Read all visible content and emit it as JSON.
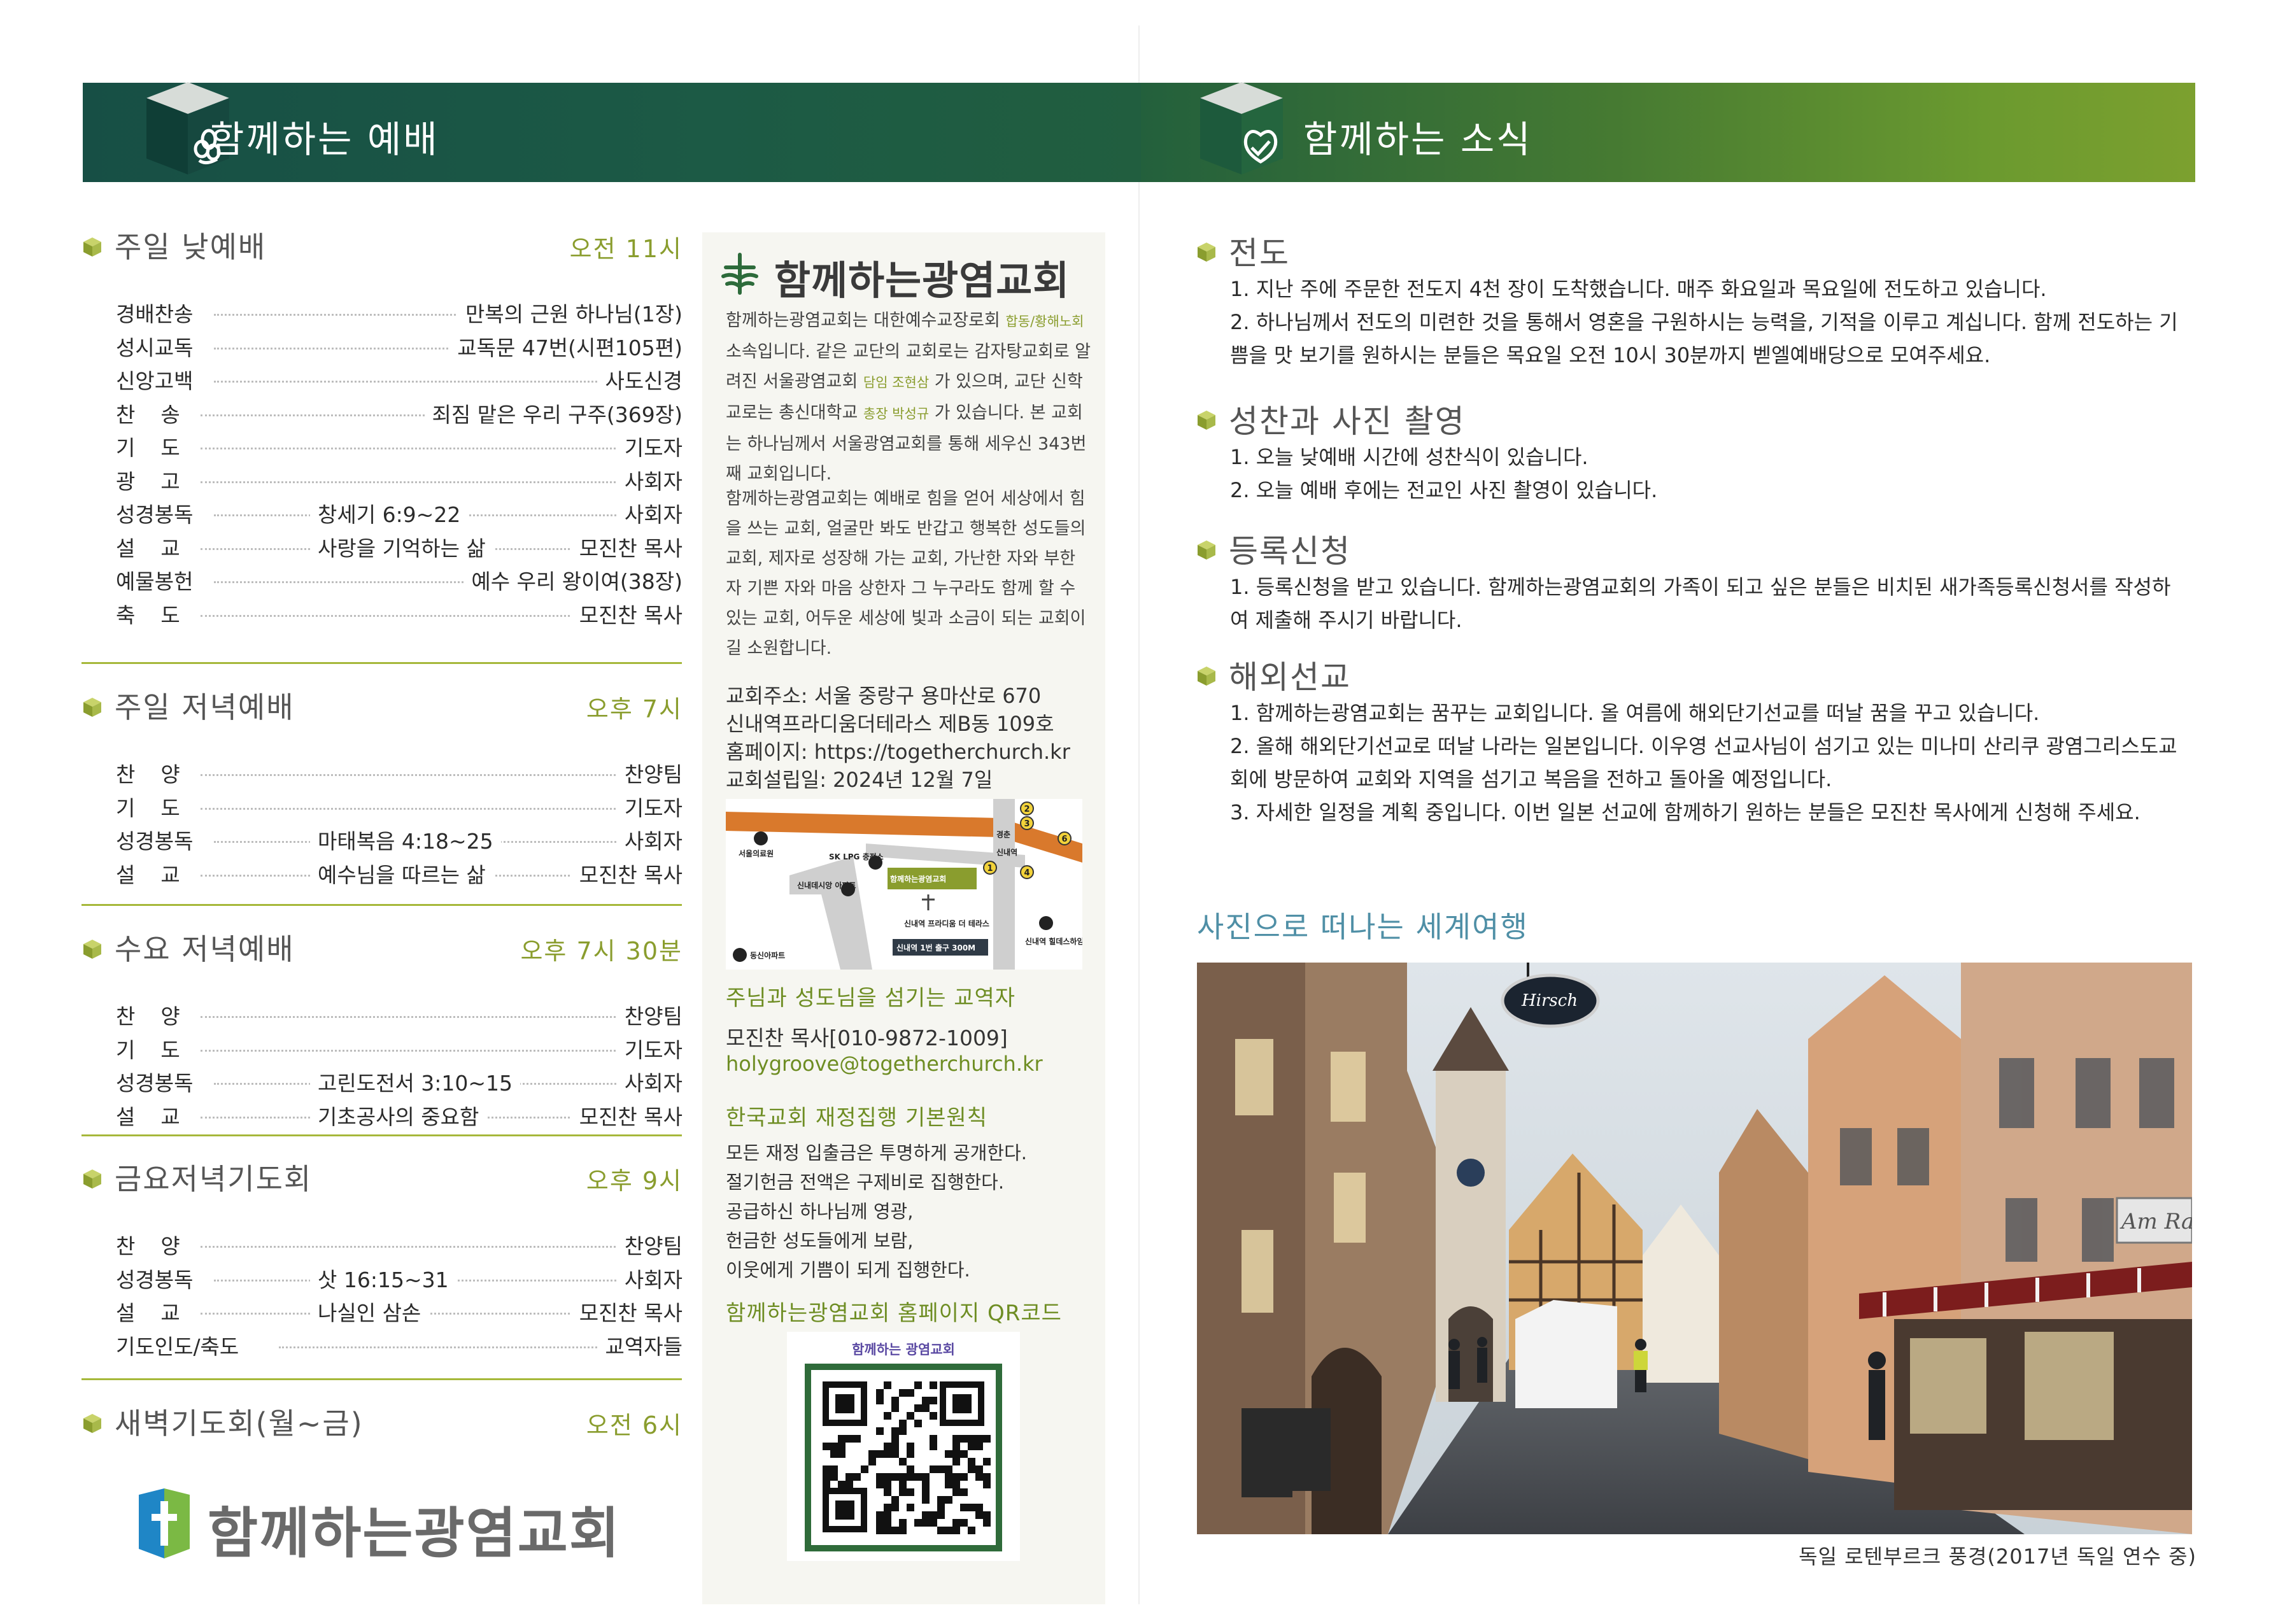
{
  "header": {
    "left_title": "함께하는 예배",
    "right_title": "함께하는 소식"
  },
  "worship": [
    {
      "title": "주일 낮예배",
      "time": "오전 11시",
      "rows": [
        {
          "label": "경배찬송",
          "mid": "",
          "value": "만복의 근원 하나님(1장)"
        },
        {
          "label": "성시교독",
          "mid": "",
          "value": "교독문 47번(시편105편)"
        },
        {
          "label": "신앙고백",
          "mid": "",
          "value": "사도신경"
        },
        {
          "label": "찬송",
          "mid": "",
          "value": "죄짐 맡은 우리 구주(369장)"
        },
        {
          "label": "기도",
          "mid": "",
          "value": "기도자"
        },
        {
          "label": "광고",
          "mid": "",
          "value": "사회자"
        },
        {
          "label": "성경봉독",
          "mid": "창세기 6:9~22",
          "value": "사회자"
        },
        {
          "label": "설교",
          "mid": "사랑을 기억하는 삶",
          "value": "모진찬 목사"
        },
        {
          "label": "예물봉헌",
          "mid": "",
          "value": "예수 우리 왕이여(38장)"
        },
        {
          "label": "축도",
          "mid": "",
          "value": "모진찬 목사"
        }
      ]
    },
    {
      "title": "주일 저녁예배",
      "time": "오후 7시",
      "rows": [
        {
          "label": "찬양",
          "mid": "",
          "value": "찬양팀"
        },
        {
          "label": "기도",
          "mid": "",
          "value": "기도자"
        },
        {
          "label": "성경봉독",
          "mid": "마태복음 4:18~25",
          "value": "사회자"
        },
        {
          "label": "설교",
          "mid": "예수님을 따르는 삶",
          "value": "모진찬 목사"
        }
      ]
    },
    {
      "title": "수요 저녁예배",
      "time": "오후 7시 30분",
      "rows": [
        {
          "label": "찬양",
          "mid": "",
          "value": "찬양팀"
        },
        {
          "label": "기도",
          "mid": "",
          "value": "기도자"
        },
        {
          "label": "성경봉독",
          "mid": "고린도전서 3:10~15",
          "value": "사회자"
        },
        {
          "label": "설교",
          "mid": "기초공사의 중요함",
          "value": "모진찬 목사"
        }
      ]
    },
    {
      "title": "금요저녁기도회",
      "time": "오후 9시",
      "rows": [
        {
          "label": "찬양",
          "mid": "",
          "value": "찬양팀"
        },
        {
          "label": "성경봉독",
          "mid": "삿 16:15~31",
          "value": "사회자"
        },
        {
          "label": "설교",
          "mid": "나실인 삼손",
          "value": "모진찬 목사"
        },
        {
          "label": "기도인도/축도",
          "mid": "",
          "value": "교역자들"
        }
      ]
    },
    {
      "title": "새벽기도회(월~금)",
      "time": "오전 6시",
      "rows": []
    }
  ],
  "logo_text": "함께하는광염교회",
  "panel": {
    "logo_text": "함께하는광염교회",
    "intro": {
      "t1": "함께하는광염교회는 대한예수교장로회 ",
      "h1": "합동/황해노회",
      "t2": " 소속입니다. 같은 교단의 교회로는 감자탕교회로 알려진 서울광염교회 ",
      "h2": "담임 조현삼",
      "t3": " 가 있으며, 교단 신학교로는 총신대학교 ",
      "h3": "총장 박성규",
      "t4": " 가 있습니다. 본 교회는 하나님께서 서울광염교회를 통해 세우신 343번째 교회입니다."
    },
    "mission": "함께하는광염교회는 예배로 힘을 얻어 세상에서 힘을 쓰는 교회, 얼굴만 봐도 반갑고 행복한 성도들의 교회, 제자로 성장해 가는 교회, 가난한 자와 부한 자 기쁜 자와 마음 상한자 그 누구라도 함께 할 수 있는 교회, 어두운 세상에 빛과 소금이 되는 교회이길 소원합니다.",
    "address": "교회주소: 서울 중랑구 용마산로 670",
    "address2": "신내역프라디움더테라스 제B동 109호",
    "homepage": "홈페이지: https://togetherchurch.kr",
    "founded": "교회설립일: 2024년 12월 7일",
    "map": {
      "labels": [
        "서울의료원",
        "SK LPG 충전소",
        "신내데시앙 아파트",
        "함께하는광염교회",
        "신내역 프라디움 더 테라스",
        "신내역 1번 출구 300M",
        "신내역 힐데스하임",
        "동신아파트",
        "경춘",
        "신내역",
        "신내역"
      ],
      "numbers": [
        "2",
        "3",
        "6",
        "1",
        "4"
      ]
    },
    "staff_title": "주님과 성도님을 섬기는 교역자",
    "staff_name": "모진찬 목사[010-9872-1009]",
    "staff_email": "holygroove@togetherchurch.kr",
    "finance_title": "한국교회 재정집행 기본원칙",
    "finance": [
      "모든 재정 입출금은 투명하게 공개한다.",
      "절기헌금 전액은 구제비로 집행한다.",
      "공급하신 하나님께 영광,",
      "헌금한 성도들에게 보람,",
      "이웃에게 기쁨이 되게 집행한다."
    ],
    "qr_title": "함께하는광염교회 홈페이지 QR코드",
    "qr_label": "함께하는 광염교회"
  },
  "news": [
    {
      "title": "전도",
      "lines": [
        "1. 지난 주에 주문한 전도지 4천 장이 도착했습니다. 매주 화요일과 목요일에 전도하고 있습니다.",
        "2. 하나님께서 전도의 미련한 것을 통해서 영혼을 구원하시는 능력을, 기적을 이루고 계십니다. 함께 전도하는 기쁨을 맛 보기를 원하시는 분들은 목요일 오전 10시 30분까지 벧엘예배당으로 모여주세요."
      ]
    },
    {
      "title": "성찬과 사진 촬영",
      "lines": [
        "1. 오늘 낮예배 시간에 성찬식이 있습니다.",
        "2. 오늘 예배 후에는 전교인 사진 촬영이 있습니다."
      ]
    },
    {
      "title": "등록신청",
      "lines": [
        "1. 등록신청을 받고 있습니다. 함께하는광염교회의 가족이 되고 싶은 분들은 비치된 새가족등록신청서를 작성하여 제출해 주시기 바랍니다."
      ]
    },
    {
      "title": "해외선교",
      "lines": [
        "1. 함께하는광염교회는 꿈꾸는 교회입니다. 올 여름에 해외단기선교를 떠날 꿈을 꾸고 있습니다.",
        "2. 올해 해외단기선교로 떠날 나라는 일본입니다. 이우영 선교사님이 섬기고 있는 미나미 산리쿠 광염그리스도교회에 방문하여 교회와 지역을 섬기고 복음을 전하고 돌아올 예정입니다.",
        "3. 자세한 일정을 계획 중입니다. 이번 일본 선교에 함께하기 원하는 분들은 모진찬 목사에게 신청해 주세요."
      ]
    }
  ],
  "travel": {
    "title": "사진으로 떠나는 세계여행",
    "sign": "Hirsch",
    "shop_sign": "Am Ra",
    "caption": "독일 로텐부르크 풍경(2017년 독일 연수 중)"
  },
  "colors": {
    "dark_green": "#174f45",
    "olive": "#8a9d2e",
    "panel_bg": "#f6f6f1",
    "orange": "#d9792c",
    "travel_blue": "#4f8fa6"
  }
}
